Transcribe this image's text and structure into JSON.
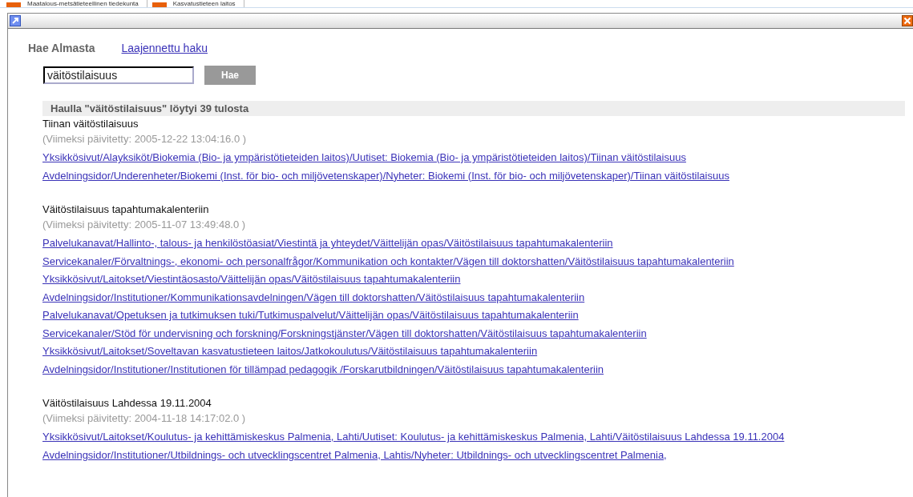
{
  "background_tabs": [
    {
      "label": "Maatalous-metsätieteellinen tiedekunta"
    },
    {
      "label": "Kasvatustieteen laitos"
    }
  ],
  "search": {
    "title": "Hae Almasta",
    "advanced_link": "Laajennettu haku",
    "value": "väitöstilaisuus",
    "button": "Hae"
  },
  "results": {
    "summary": "Haulla \"väitöstilaisuus\" löytyi 39 tulosta",
    "items": [
      {
        "title": "Tiinan väitöstilaisuus",
        "updated": "(Viimeksi päivitetty: 2005-12-22 13:04:16.0 )",
        "paths": [
          "Yksikkösivut/Alayksiköt/Biokemia (Bio- ja ympäristötieteiden laitos)/Uutiset: Biokemia (Bio- ja ympäristötieteiden laitos)/Tiinan väitöstilaisuus",
          "Avdelningsidor/Underenheter/Biokemi (Inst. för bio- och miljövetenskaper)/Nyheter: Biokemi (Inst. för bio- och miljövetenskaper)/Tiinan väitöstilaisuus"
        ]
      },
      {
        "title": "Väitöstilaisuus tapahtumakalenteriin",
        "updated": "(Viimeksi päivitetty: 2005-11-07 13:49:48.0 )",
        "paths": [
          "Palvelukanavat/Hallinto-, talous- ja henkilöstöasiat/Viestintä ja yhteydet/Väittelijän opas/Väitöstilaisuus tapahtumakalenteriin",
          "Servicekanaler/Förvaltnings-, ekonomi- och personalfrågor/Kommunikation och kontakter/Vägen till doktorshatten/Väitöstilaisuus tapahtumakalenteriin",
          "Yksikkösivut/Laitokset/Viestintäosasto/Väittelijän opas/Väitöstilaisuus tapahtumakalenteriin",
          "Avdelningsidor/Institutioner/Kommunikationsavdelningen/Vägen till doktorshatten/Väitöstilaisuus tapahtumakalenteriin",
          "Palvelukanavat/Opetuksen ja tutkimuksen tuki/Tutkimuspalvelut/Väittelijän opas/Väitöstilaisuus tapahtumakalenteriin",
          "Servicekanaler/Stöd för undervisning och forskning/Forskningstjänster/Vägen till doktorshatten/Väitöstilaisuus tapahtumakalenteriin",
          "Yksikkösivut/Laitokset/Soveltavan kasvatustieteen laitos/Jatkokoulutus/Väitöstilaisuus tapahtumakalenteriin",
          "Avdelningsidor/Institutioner/Institutionen för tillämpad pedagogik /Forskarutbildningen/Väitöstilaisuus tapahtumakalenteriin"
        ]
      },
      {
        "title": "Väitöstilaisuus Lahdessa 19.11.2004",
        "updated": "(Viimeksi päivitetty: 2004-11-18 14:17:02.0 )",
        "paths": [
          "Yksikkösivut/Laitokset/Koulutus- ja kehittämiskeskus Palmenia, Lahti/Uutiset: Koulutus- ja kehittämiskeskus Palmenia, Lahti/Väitöstilaisuus Lahdessa 19.11.2004",
          "Avdelningsidor/Institutioner/Utbildnings- och utvecklingscentret Palmenia, Lahtis/Nyheter: Utbildnings- och utvecklingscentret Palmenia,"
        ]
      }
    ]
  }
}
